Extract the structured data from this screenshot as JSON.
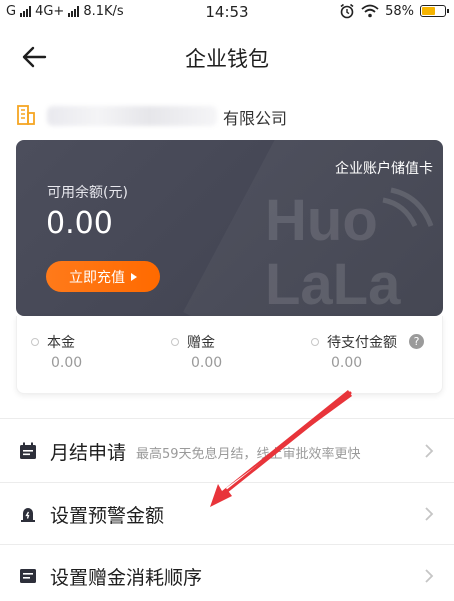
{
  "status_bar": {
    "carrier": "G",
    "network": "4G+",
    "speed": "8.1K/s",
    "time": "14:53",
    "battery": "58%",
    "battery_level": 0.58
  },
  "nav": {
    "title": "企业钱包"
  },
  "company": {
    "name_visible": "有限公司"
  },
  "card": {
    "type_label": "企业账户储值卡",
    "balance_label": "可用余额(元)",
    "balance_value": "0.00",
    "recharge_label": "立即充值",
    "watermark": "HuoLaLa"
  },
  "sub_balances": [
    {
      "label": "本金",
      "value": "0.00"
    },
    {
      "label": "赠金",
      "value": "0.00"
    },
    {
      "label": "待支付金额",
      "value": "0.00"
    }
  ],
  "menu": [
    {
      "title": "月结申请",
      "desc": "最高59天免息月结，线上审批效率更快"
    },
    {
      "title": "设置预警金额"
    },
    {
      "title": "设置赠金消耗顺序"
    }
  ],
  "colors": {
    "accent": "#ff6a00",
    "card": "#474957",
    "annotation": "#e8343a"
  }
}
